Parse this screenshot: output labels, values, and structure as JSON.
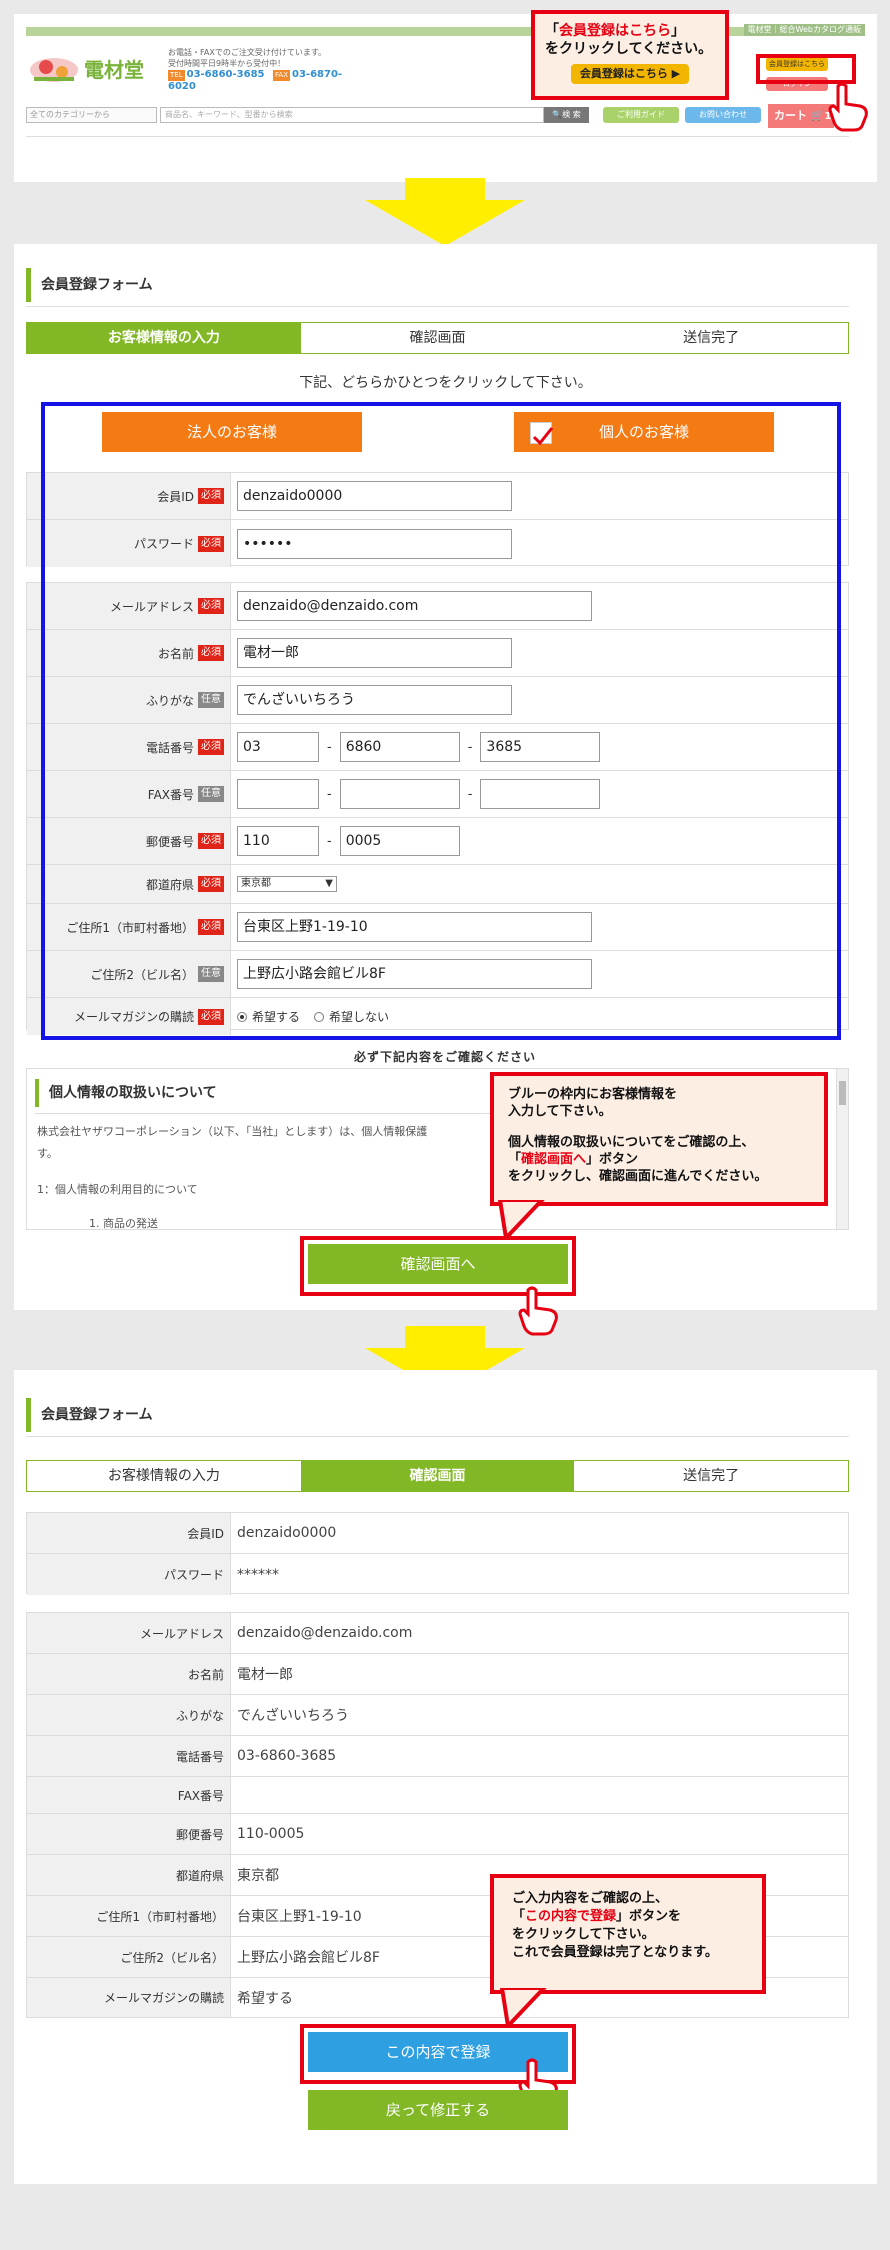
{
  "header": {
    "top_links": "電材堂｜総合Webカタログ通販",
    "logo": "電材堂",
    "info_line1": "お電話・FAXでのご注文受け付けています。",
    "info_line2": "受付時間平日9時半から受付中！",
    "tel_label": "TEL",
    "tel": "03-6860-3685",
    "fax_label": "FAX",
    "fax": "03-6870-6020",
    "category_select": "全てのカテゴリーから",
    "search_placeholder": "商品名、キーワード、型番から検索",
    "search_button": "検 索",
    "guide": "ご利用ガイド",
    "contact": "お問い合わせ",
    "cart": "カート",
    "cart_count": "1",
    "register_small": "会員登録はこちら",
    "login_small": "ログイン"
  },
  "callout1": {
    "line1_pre": "「",
    "line1_em": "会員登録はこちら",
    "line1_post": "」",
    "line2": "をクリックしてください。",
    "button": "会員登録はこちら ▶"
  },
  "form": {
    "title": "会員登録フォーム",
    "steps": [
      "お客様情報の入力",
      "確認画面",
      "送信完了"
    ],
    "instruction": "下記、どちらかひとつをクリックして下さい。",
    "corporate": "法人のお客様",
    "individual": "個人のお客様",
    "required": "必須",
    "optional": "任意",
    "fields": {
      "member_id": {
        "label": "会員ID",
        "value": "denzaido0000"
      },
      "password": {
        "label": "パスワード",
        "value": "••••••"
      },
      "email": {
        "label": "メールアドレス",
        "value": "denzaido@denzaido.com"
      },
      "name": {
        "label": "お名前",
        "value": "電材一郎"
      },
      "kana": {
        "label": "ふりがな",
        "value": "でんざいいちろう"
      },
      "tel": {
        "label": "電話番号",
        "v1": "03",
        "v2": "6860",
        "v3": "3685"
      },
      "fax": {
        "label": "FAX番号"
      },
      "zip": {
        "label": "郵便番号",
        "v1": "110",
        "v2": "0005"
      },
      "pref": {
        "label": "都道府県",
        "value": "東京都"
      },
      "addr1": {
        "label": "ご住所1（市町村番地）",
        "value": "台東区上野1-19-10"
      },
      "addr2": {
        "label": "ご住所2（ビル名）",
        "value": "上野広小路会館ビル8F"
      },
      "magazine": {
        "label": "メールマガジンの購読",
        "yes": "希望する",
        "no": "希望しない"
      }
    },
    "confirm_note": "必ず下記内容をご確認ください",
    "privacy_title": "個人情報の取扱いについて",
    "privacy_text1": "株式会社ヤザワコーポレーション（以下、「当社」とします）は、個人情報保護",
    "privacy_text2": "す。",
    "privacy_item": "1：個人情報の利用目的について",
    "privacy_sub": "1. 商品の発送",
    "confirm_button": "確認画面へ"
  },
  "callout2": {
    "line1": "ブルーの枠内にお客様情報を",
    "line2": "入力して下さい。",
    "line3": "個人情報の取扱いについてをご確認の上、",
    "line4_pre": "「",
    "line4_em": "確認画面へ",
    "line4_post": "」ボタン",
    "line5": "をクリックし、確認画面に進んでください。"
  },
  "confirm": {
    "title": "会員登録フォーム",
    "steps": [
      "お客様情報の入力",
      "確認画面",
      "送信完了"
    ],
    "rows": {
      "member_id": "denzaido0000",
      "password": "******",
      "email": "denzaido@denzaido.com",
      "name": "電材一郎",
      "kana": "でんざいいちろう",
      "tel": "03-6860-3685",
      "fax": "",
      "zip": "110-0005",
      "pref": "東京都",
      "addr1": "台東区上野1-19-10",
      "addr2": "上野広小路会館ビル8F",
      "magazine": "希望する"
    },
    "register_button": "この内容で登録",
    "back_button": "戻って修正する"
  },
  "callout3": {
    "line1": "ご入力内容をご確認の上、",
    "line2_pre": "「",
    "line2_em": "この内容で登録",
    "line2_post": "」ボタンを",
    "line3": "をクリックして下さい。",
    "line4": "これで会員登録は完了となります。"
  },
  "colors": {
    "green": "#82b825",
    "orange": "#f47a14",
    "blue_frame": "#1414e6",
    "red": "#e60012",
    "yellow_arrow": "#ffee00",
    "blue_button": "#2e9fe0"
  }
}
